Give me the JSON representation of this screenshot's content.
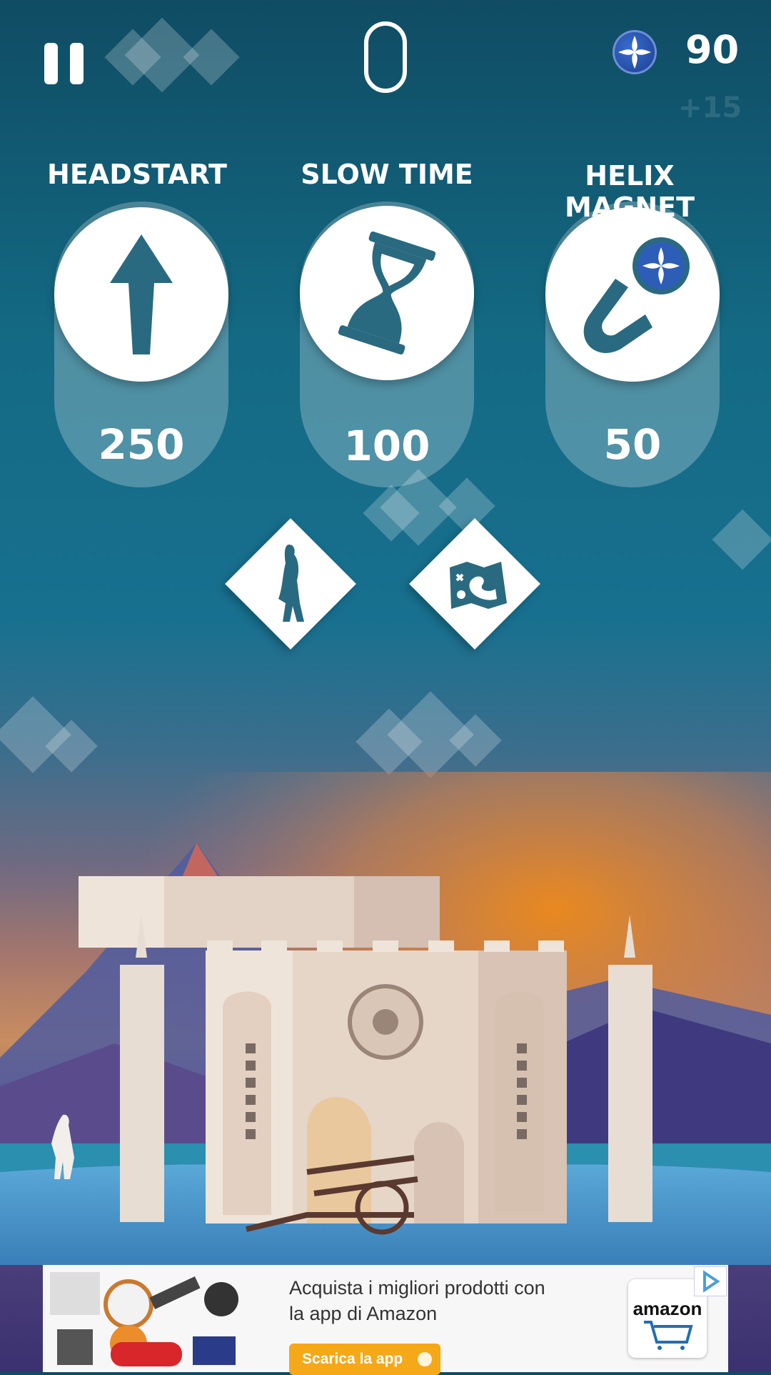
{
  "hud": {
    "score": "0",
    "coins": "90",
    "coin_bonus": "+15"
  },
  "powerups": [
    {
      "title": "HEADSTART",
      "price": "250",
      "icon": "arrow-up-icon"
    },
    {
      "title": "SLOW TIME",
      "price": "100",
      "icon": "hourglass-icon"
    },
    {
      "title": "HELIX MAGNET",
      "price": "50",
      "icon": "magnet-icon"
    }
  ],
  "menu_buttons": [
    {
      "icon": "character-icon"
    },
    {
      "icon": "map-icon"
    }
  ],
  "ad": {
    "text_line1": "Acquista i migliori prodotti con",
    "text_line2": "la app di Amazon",
    "button_label": "Scarica la app",
    "logo": "amazon"
  },
  "colors": {
    "card": "#ffffff",
    "icon": "#2a6a80",
    "coin": "#2e5db8",
    "ad_button": "#f5a818"
  }
}
